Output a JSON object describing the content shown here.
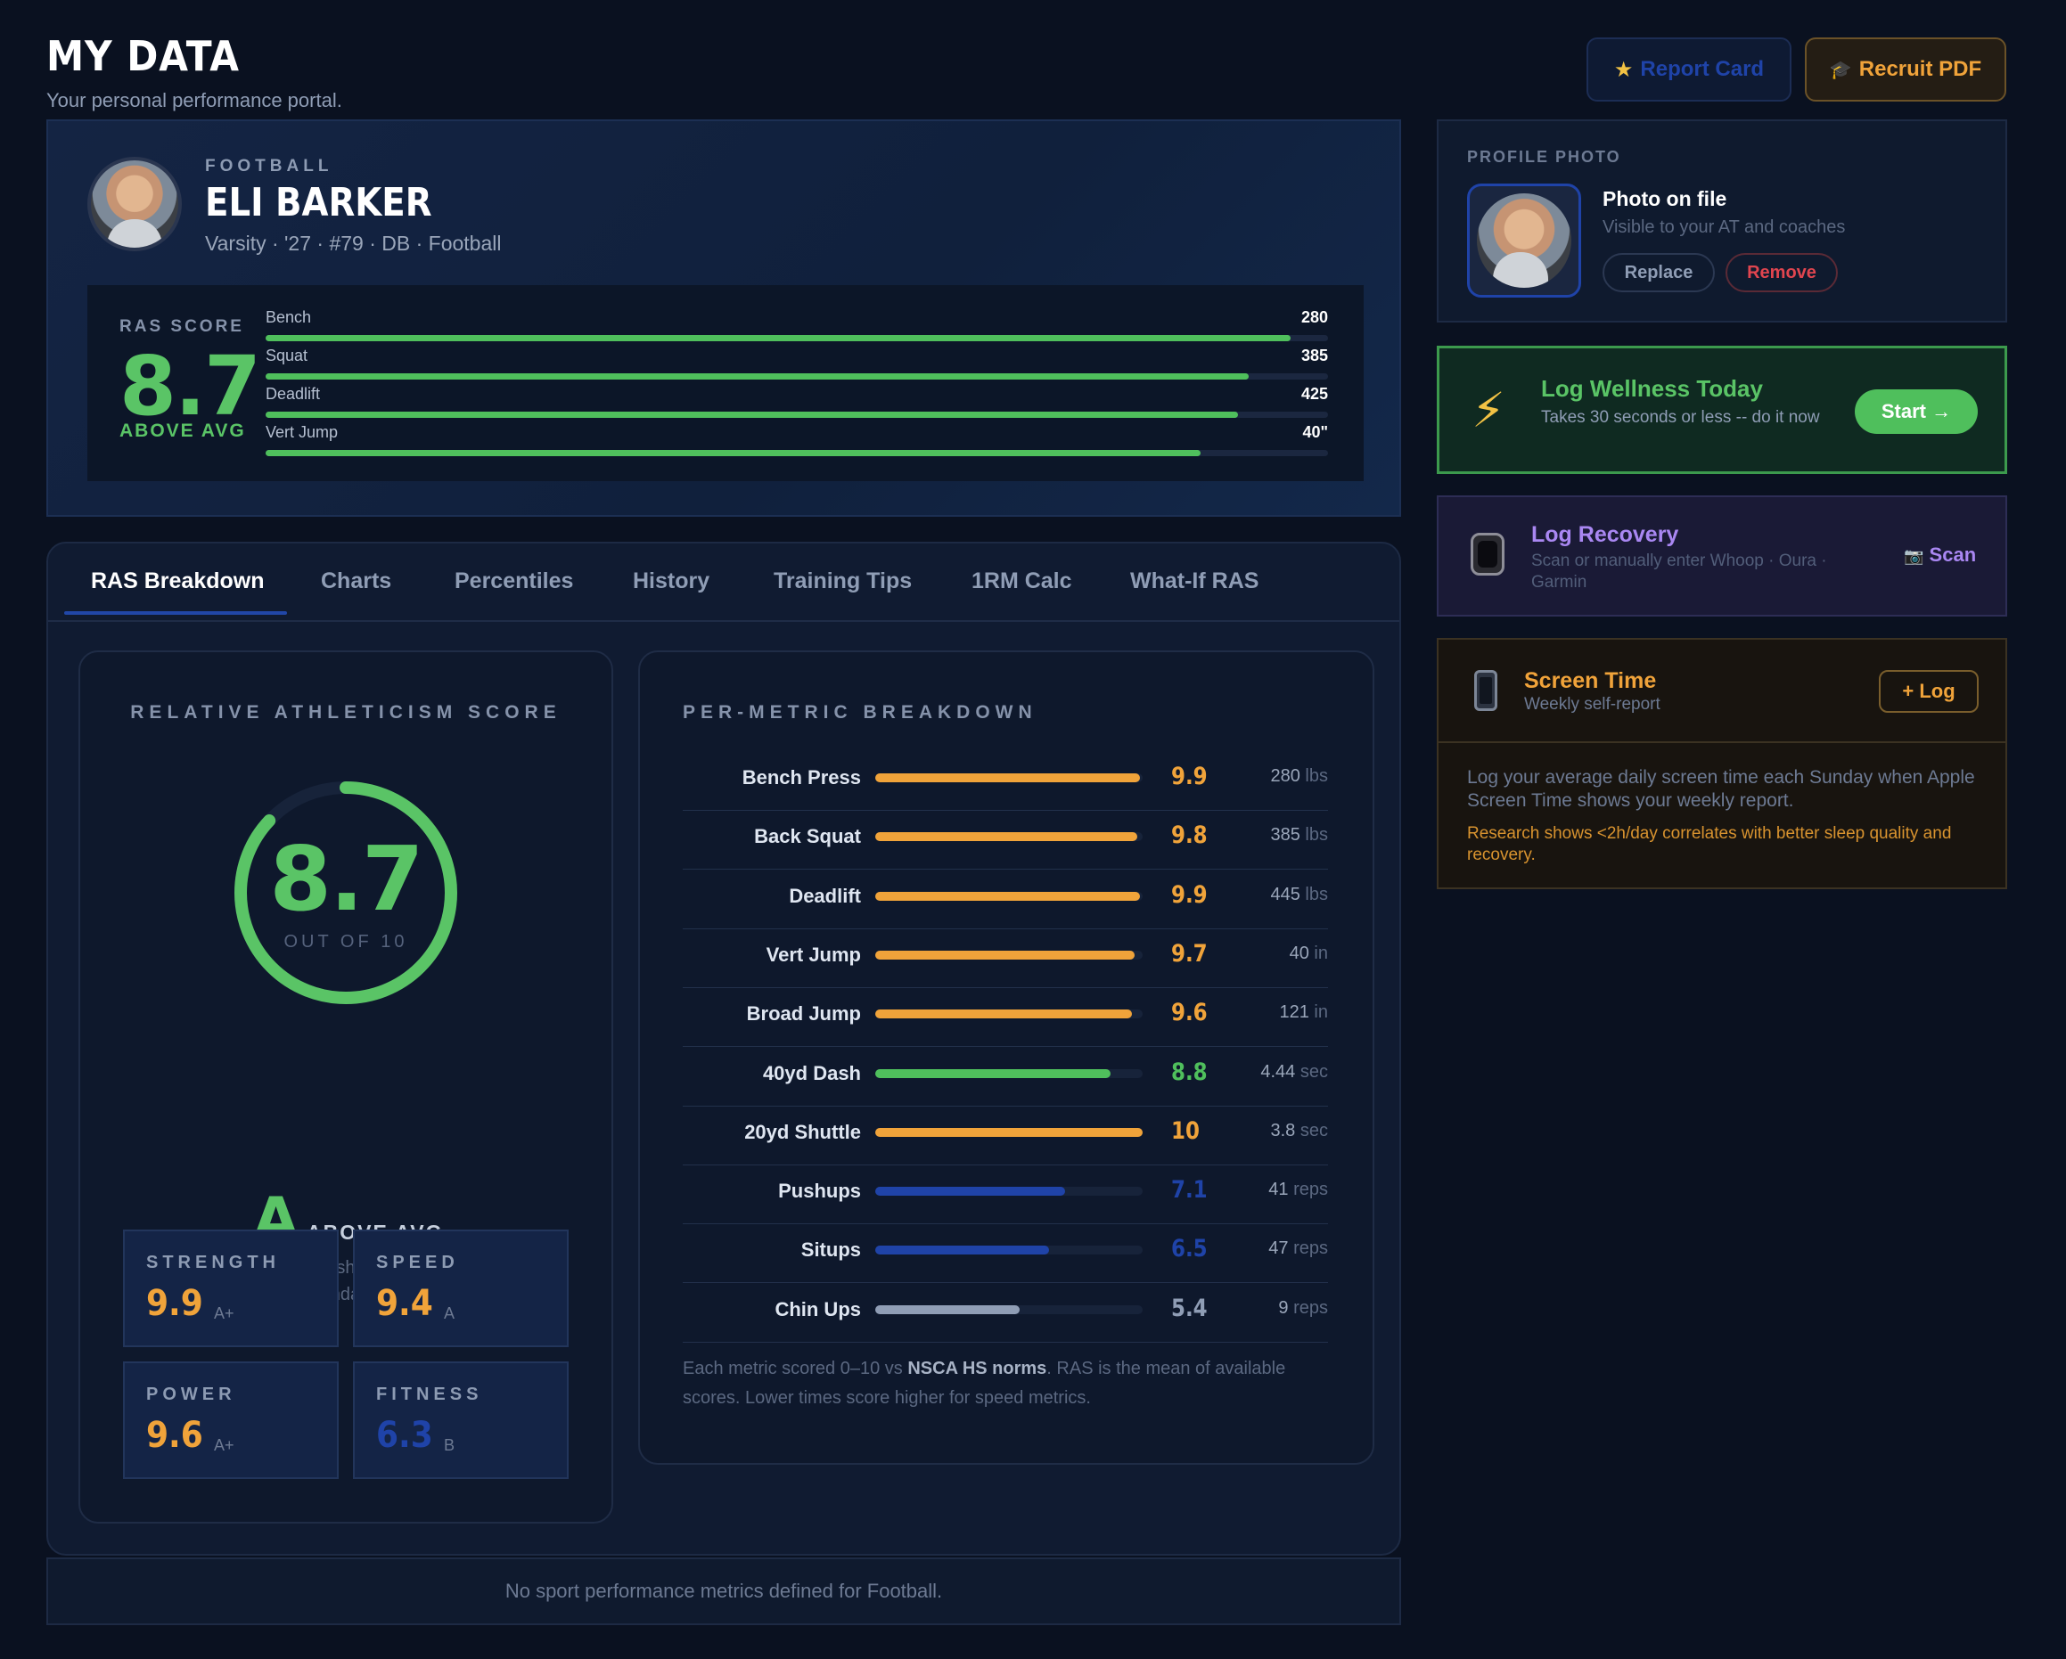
{
  "header": {
    "title": "MY DATA",
    "subtitle": "Your personal performance portal.",
    "report_card_label": "Report Card",
    "recruit_pdf_label": "Recruit PDF"
  },
  "profile": {
    "sport": "FOOTBALL",
    "name": "ELI BARKER",
    "meta": "Varsity · '27 · #79 · DB · Football",
    "ras_label": "RAS SCORE",
    "ras_score": "8.7",
    "ras_tag": "ABOVE AVG",
    "lifts": [
      {
        "name": "Bench",
        "value": "280",
        "fill": 0.965
      },
      {
        "name": "Squat",
        "value": "385",
        "fill": 0.925
      },
      {
        "name": "Deadlift",
        "value": "425",
        "fill": 0.915
      },
      {
        "name": "Vert Jump",
        "value": "40\"",
        "fill": 0.88
      }
    ]
  },
  "tabs": [
    {
      "label": "RAS Breakdown",
      "active": true
    },
    {
      "label": "Charts"
    },
    {
      "label": "Percentiles"
    },
    {
      "label": "History"
    },
    {
      "label": "Training Tips"
    },
    {
      "label": "1RM Calc"
    },
    {
      "label": "What-If RAS"
    }
  ],
  "ras_breakdown": {
    "title": "RELATIVE ATHLETICISM SCORE",
    "score": "8.7",
    "score_fraction": 0.87,
    "out_of": "OUT OF 10",
    "grade": "A",
    "grade_tag": "ABOVE AVG",
    "norm_note": "Normed against published NSCA high school standards",
    "subscores": [
      {
        "label": "STRENGTH",
        "value": "9.9",
        "grade": "A+",
        "color": "#f0a33a"
      },
      {
        "label": "SPEED",
        "value": "9.4",
        "grade": "A",
        "color": "#f0a33a"
      },
      {
        "label": "POWER",
        "value": "9.6",
        "grade": "A+",
        "color": "#f0a33a"
      },
      {
        "label": "FITNESS",
        "value": "6.3",
        "grade": "B",
        "color": "#1f43a8"
      }
    ]
  },
  "per_metric": {
    "title": "PER-METRIC BREAKDOWN",
    "rows": [
      {
        "name": "Bench Press",
        "score": "9.9",
        "raw": "280",
        "unit": "lbs",
        "color": "#f0a33a",
        "fill": 0.99
      },
      {
        "name": "Back Squat",
        "score": "9.8",
        "raw": "385",
        "unit": "lbs",
        "color": "#f0a33a",
        "fill": 0.98
      },
      {
        "name": "Deadlift",
        "score": "9.9",
        "raw": "445",
        "unit": "lbs",
        "color": "#f0a33a",
        "fill": 0.99
      },
      {
        "name": "Vert Jump",
        "score": "9.7",
        "raw": "40",
        "unit": "in",
        "color": "#f0a33a",
        "fill": 0.97
      },
      {
        "name": "Broad Jump",
        "score": "9.6",
        "raw": "121",
        "unit": "in",
        "color": "#f0a33a",
        "fill": 0.96
      },
      {
        "name": "40yd Dash",
        "score": "8.8",
        "raw": "4.44",
        "unit": "sec",
        "color": "#4fbf5c",
        "fill": 0.88
      },
      {
        "name": "20yd Shuttle",
        "score": "10",
        "raw": "3.8",
        "unit": "sec",
        "color": "#f0a33a",
        "fill": 1.0
      },
      {
        "name": "Pushups",
        "score": "7.1",
        "raw": "41",
        "unit": "reps",
        "color": "#1f43a8",
        "fill": 0.71
      },
      {
        "name": "Situps",
        "score": "6.5",
        "raw": "47",
        "unit": "reps",
        "color": "#1f43a8",
        "fill": 0.65
      },
      {
        "name": "Chin Ups",
        "score": "5.4",
        "raw": "9",
        "unit": "reps",
        "color": "#8f9db5",
        "fill": 0.54
      }
    ],
    "foot_pre": "Each metric scored 0–10 vs ",
    "foot_bold": "NSCA HS norms",
    "foot_post": ". RAS is the mean of available scores. Lower times score higher for speed metrics."
  },
  "no_sport": "No sport performance metrics defined for Football.",
  "photo_card": {
    "label": "PROFILE PHOTO",
    "title": "Photo on file",
    "desc": "Visible to your AT and coaches",
    "replace": "Replace",
    "remove": "Remove"
  },
  "wellness": {
    "title": "Log Wellness Today",
    "desc": "Takes 30 seconds or less -- do it now",
    "button": "Start →"
  },
  "recovery": {
    "title": "Log Recovery",
    "desc": "Scan or manually enter Whoop · Oura · Garmin",
    "button": "Scan"
  },
  "screen_time": {
    "title": "Screen Time",
    "desc": "Weekly self-report",
    "button": "+ Log",
    "body": "Log your average daily screen time each Sunday when Apple Screen Time shows your weekly report.",
    "research": "Research shows <2h/day correlates with better sleep quality and recovery."
  },
  "icons": {
    "report_card": "star-icon",
    "recruit_pdf": "graduation-cap-icon",
    "wellness": "lightning-icon",
    "recovery": "smartwatch-icon",
    "scan": "camera-icon",
    "screen_time": "phone-icon"
  },
  "colors": {
    "accent_green": "#5ac466",
    "accent_orange": "#f0a33a",
    "accent_blue": "#1f43a8",
    "accent_purple": "#a987f2"
  }
}
